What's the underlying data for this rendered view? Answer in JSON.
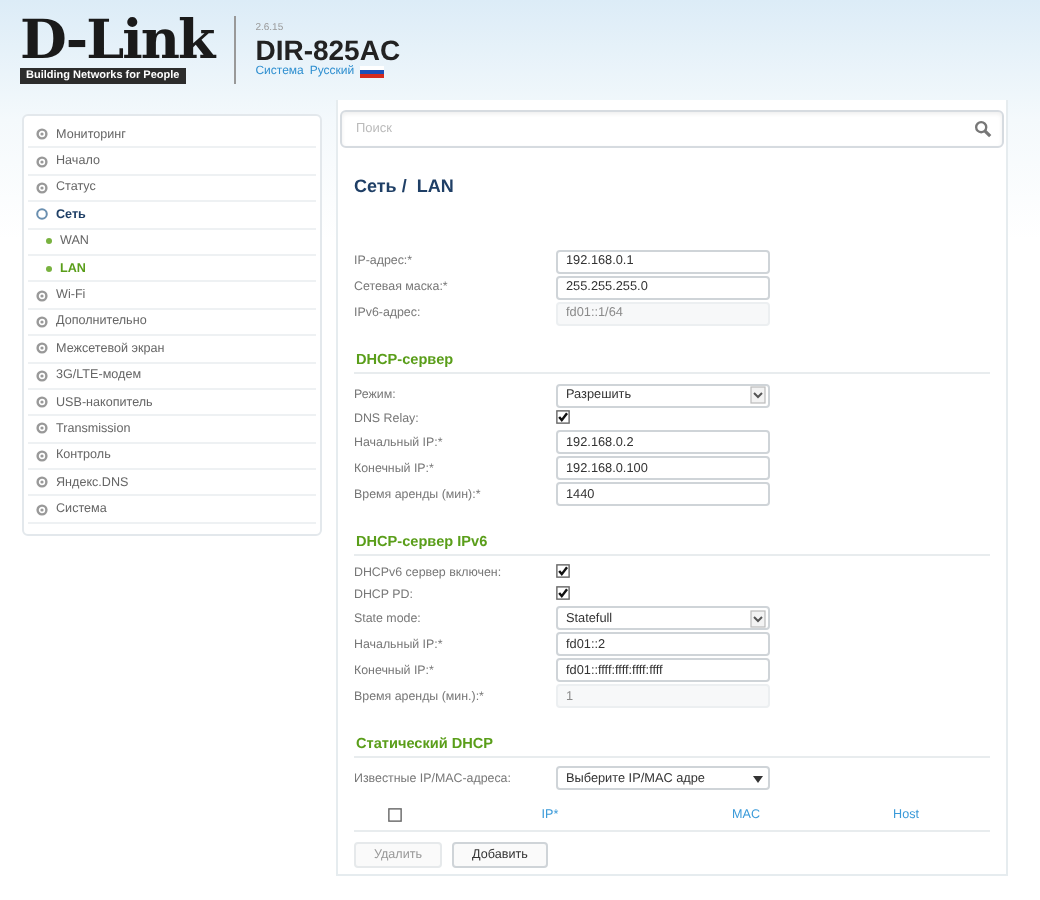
{
  "header": {
    "brand": "D-Link",
    "tagline": "Building Networks for People",
    "version": "2.6.15",
    "model": "DIR-825AC",
    "links": [
      {
        "label": "Система"
      },
      {
        "label": "Русский"
      }
    ]
  },
  "sidebar": {
    "items": [
      {
        "label": "Мониторинг",
        "expanded": false
      },
      {
        "label": "Начало",
        "expanded": false
      },
      {
        "label": "Статус",
        "expanded": false
      },
      {
        "label": "Сеть",
        "expanded": true,
        "children": [
          {
            "label": "WAN",
            "selected": false
          },
          {
            "label": "LAN",
            "selected": true
          }
        ]
      },
      {
        "label": "Wi-Fi",
        "expanded": false
      },
      {
        "label": "Дополнительно",
        "expanded": false
      },
      {
        "label": "Межсетевой экран",
        "expanded": false
      },
      {
        "label": "3G/LTE-модем",
        "expanded": false
      },
      {
        "label": "USB-накопитель",
        "expanded": false
      },
      {
        "label": "Transmission",
        "expanded": false
      },
      {
        "label": "Контроль",
        "expanded": false
      },
      {
        "label": "Яндекс.DNS",
        "expanded": false
      },
      {
        "label": "Система",
        "expanded": false
      }
    ]
  },
  "search": {
    "placeholder": "Поиск"
  },
  "page_title": "Сеть /  LAN",
  "sections": [
    {
      "rows": [
        {
          "kind": "text",
          "label": "IP-адрес:*",
          "value": "192.168.0.1",
          "disabled": false
        },
        {
          "kind": "text",
          "label": "Сетевая маска:*",
          "value": "255.255.255.0",
          "disabled": false
        },
        {
          "kind": "text",
          "label": "IPv6-адрес:",
          "value": "fd01::1/64",
          "disabled": true
        }
      ]
    },
    {
      "title": "DHCP-сервер",
      "rows": [
        {
          "kind": "select",
          "label": "Режим:",
          "value": "Разрешить",
          "disabled": false
        },
        {
          "kind": "checkbox",
          "label": "DNS Relay:",
          "checked": true
        },
        {
          "kind": "text",
          "label": "Начальный IP:*",
          "value": "192.168.0.2",
          "disabled": false
        },
        {
          "kind": "text",
          "label": "Конечный IP:*",
          "value": "192.168.0.100",
          "disabled": false
        },
        {
          "kind": "text",
          "label": "Время аренды (мин):*",
          "value": "1440",
          "disabled": false
        }
      ]
    },
    {
      "title": "DHCP-сервер IPv6",
      "rows": [
        {
          "kind": "checkbox",
          "label": "DHCPv6 сервер включен:",
          "checked": true
        },
        {
          "kind": "checkbox",
          "label": "DHCP PD:",
          "checked": true
        },
        {
          "kind": "select",
          "label": "State mode:",
          "value": "Statefull",
          "disabled": false
        },
        {
          "kind": "text",
          "label": "Начальный IP:*",
          "value": "fd01::2",
          "disabled": false
        },
        {
          "kind": "text",
          "label": "Конечный IP:*",
          "value": "fd01::ffff:ffff:ffff:ffff",
          "disabled": false
        },
        {
          "kind": "text",
          "label": "Время аренды (мин.):*",
          "value": "1",
          "disabled": true
        }
      ]
    },
    {
      "title": "Статический DHCP",
      "rows": [
        {
          "kind": "select",
          "label": "Известные IP/MAC-адреса:",
          "value": "Выберите IP/MAC адре",
          "disabled": false
        }
      ]
    }
  ],
  "table": {
    "select_all": {
      "checked": false
    },
    "columns": [
      "IP*",
      "MAC",
      "Host"
    ]
  },
  "buttons": [
    {
      "label": "Удалить",
      "disabled": true
    },
    {
      "label": "Добавить",
      "disabled": false
    }
  ]
}
